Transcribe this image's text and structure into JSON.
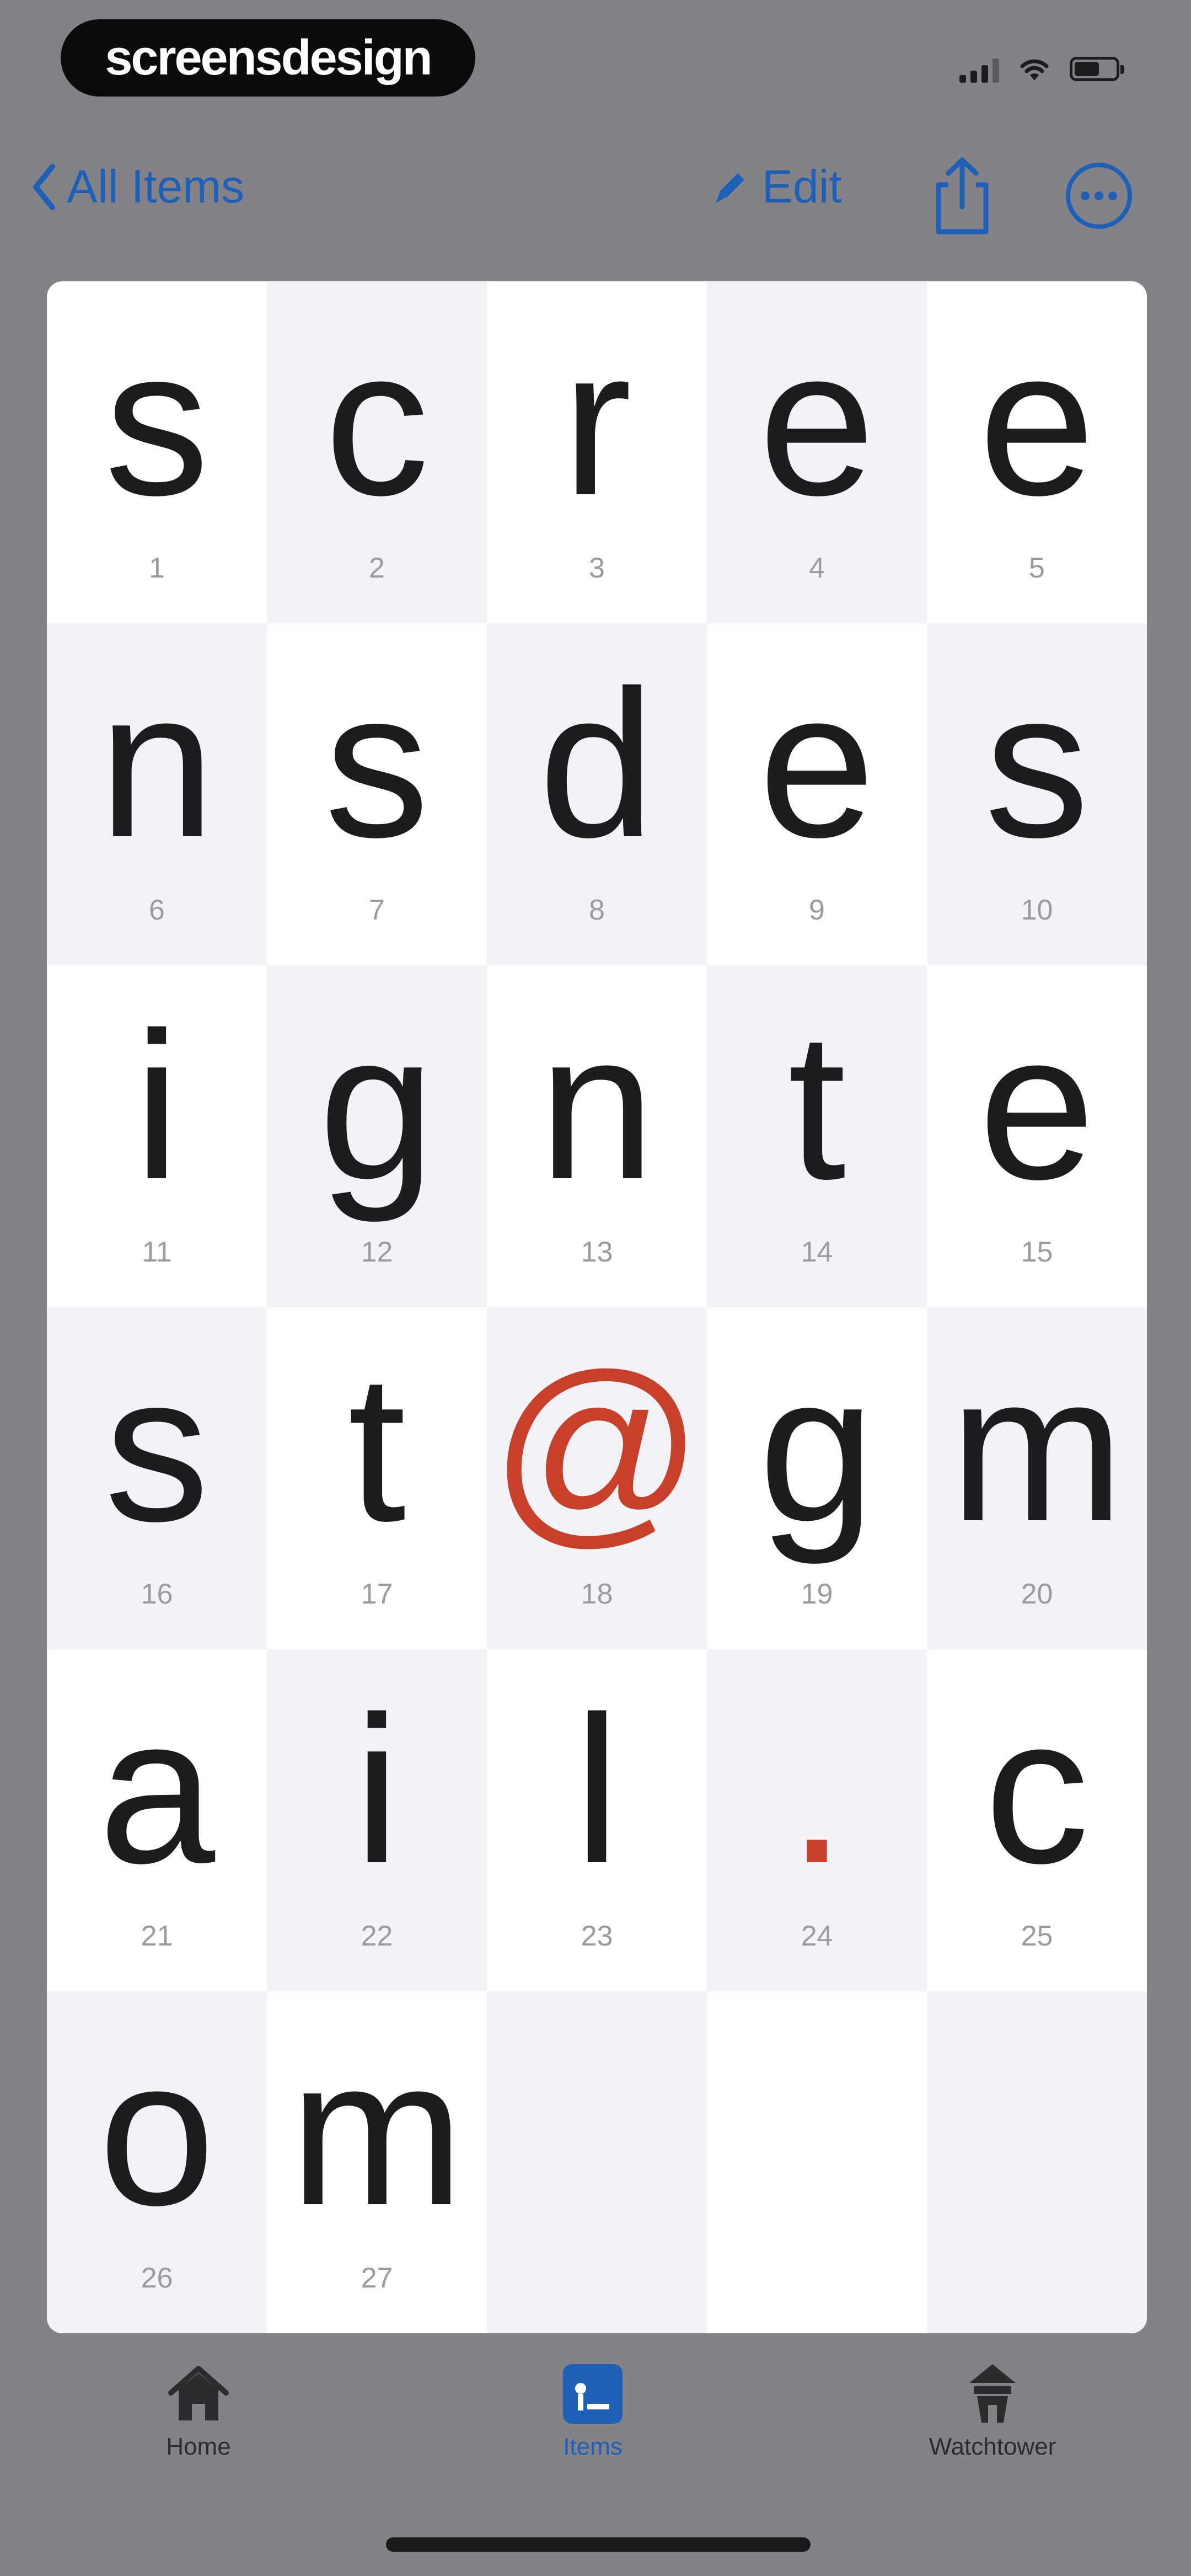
{
  "status_bar": {
    "brand": "screensdesign",
    "icons": [
      "signal-icon",
      "wifi-icon",
      "battery-icon"
    ]
  },
  "nav": {
    "back_label": "All Items",
    "edit_label": "Edit",
    "icons": [
      "chevron-left-icon",
      "pencil-icon",
      "share-icon",
      "more-icon"
    ]
  },
  "grid": {
    "cells": [
      {
        "char": "s",
        "index": "1"
      },
      {
        "char": "c",
        "index": "2"
      },
      {
        "char": "r",
        "index": "3"
      },
      {
        "char": "e",
        "index": "4"
      },
      {
        "char": "e",
        "index": "5"
      },
      {
        "char": "n",
        "index": "6"
      },
      {
        "char": "s",
        "index": "7"
      },
      {
        "char": "d",
        "index": "8"
      },
      {
        "char": "e",
        "index": "9"
      },
      {
        "char": "s",
        "index": "10"
      },
      {
        "char": "i",
        "index": "11"
      },
      {
        "char": "g",
        "index": "12"
      },
      {
        "char": "n",
        "index": "13"
      },
      {
        "char": "t",
        "index": "14"
      },
      {
        "char": "e",
        "index": "15"
      },
      {
        "char": "s",
        "index": "16"
      },
      {
        "char": "t",
        "index": "17"
      },
      {
        "char": "@",
        "index": "18"
      },
      {
        "char": "g",
        "index": "19"
      },
      {
        "char": "m",
        "index": "20"
      },
      {
        "char": "a",
        "index": "21"
      },
      {
        "char": "i",
        "index": "22"
      },
      {
        "char": "l",
        "index": "23"
      },
      {
        "char": ".",
        "index": "24"
      },
      {
        "char": "c",
        "index": "25"
      },
      {
        "char": "o",
        "index": "26"
      },
      {
        "char": "m",
        "index": "27"
      },
      {
        "char": "",
        "index": ""
      },
      {
        "char": "",
        "index": ""
      },
      {
        "char": "",
        "index": ""
      }
    ]
  },
  "tab_bar": {
    "items": [
      {
        "label": "Home",
        "icon": "house-icon",
        "selected": false
      },
      {
        "label": "Items",
        "icon": "items-icon",
        "selected": true
      },
      {
        "label": "Watchtower",
        "icon": "watchtower-icon",
        "selected": false
      }
    ]
  },
  "colors": {
    "accent_blue": "#1e5fb8",
    "symbol_red": "#c8402a",
    "text_dark": "#1c1c1f",
    "shaded_cell": "#f3f2f6"
  }
}
